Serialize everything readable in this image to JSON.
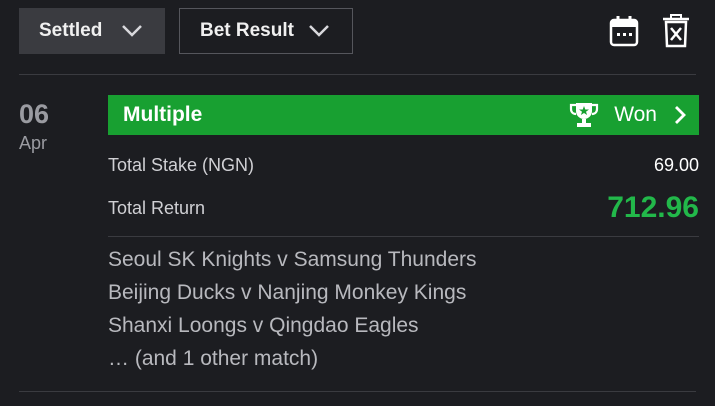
{
  "filters": {
    "status_label": "Settled",
    "result_label": "Bet Result"
  },
  "icons": {
    "calendar": "calendar-icon",
    "delete": "delete-icon",
    "trophy": "trophy-icon",
    "chevron": "chevron-down-icon",
    "arrow": "chevron-right-icon"
  },
  "bet": {
    "date_day": "06",
    "date_month": "Apr",
    "type": "Multiple",
    "status": "Won",
    "total_stake_label": "Total Stake (NGN)",
    "total_stake_value": "69.00",
    "total_return_label": "Total Return",
    "total_return_value": "712.96",
    "matches": [
      "Seoul SK Knights v Samsung Thunders",
      "Beijing Ducks v Nanjing Monkey Kings",
      "Shanxi Loongs v Qingdao Eagles",
      "… (and 1 other match)"
    ]
  },
  "colors": {
    "background": "#1c1d21",
    "won_green": "#18a031",
    "return_green": "#22b84a",
    "button_bg": "#3a3b40"
  }
}
